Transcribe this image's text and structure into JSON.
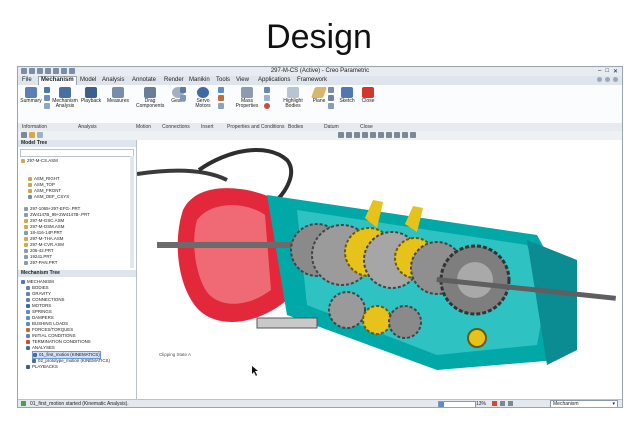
{
  "slide": {
    "title": "Design"
  },
  "window": {
    "title": "297-M-CS (Active) - Creo Parametric"
  },
  "menu": {
    "tabs": [
      "File",
      "Mechanism",
      "Model",
      "Analysis",
      "Annotate",
      "Render",
      "Manikin",
      "Tools",
      "View",
      "Applications",
      "Framework"
    ],
    "active": "Mechanism"
  },
  "ribbon": {
    "buttons": {
      "summary": "Summary",
      "mechanism_analysis": "Mechanism Analysis",
      "playback": "Playback",
      "measures": "Measures",
      "drag_components": "Drag Components",
      "gears": "Gears",
      "servo_motors": "Servo Motors",
      "mass_properties": "Mass Properties",
      "highlight_bodies": "Highlight Bodies",
      "plane": "Plane",
      "sketch": "Sketch",
      "close": "Close"
    },
    "groups": {
      "information": "Information",
      "analysis": "Analysis",
      "motion": "Motion",
      "connections": "Connections",
      "insert": "Insert",
      "properties": "Properties and Conditions",
      "bodies": "Bodies",
      "datum": "Datum",
      "close": "Close"
    }
  },
  "model_tree": {
    "header": "Model Tree",
    "items": [
      "297-M-CS.ASM",
      "ASM_RIGHT",
      "ASM_TOP",
      "ASM_FRONT",
      "ASM_DEF_CSYS",
      "297-1065+297-EFG-.PRT",
      "2W4147B_99+2W4147B-.PRT",
      "297-M-GSC.ASM",
      "297-M-DSM.ASM",
      "18-416-14P.PRT",
      "297-M-THA.ASM",
      "297-M-CVR.ASM",
      "206-42.PRT",
      "19241.PRT",
      "297-PAN.PRT"
    ]
  },
  "mechanism_tree": {
    "header": "Mechanism Tree",
    "items": [
      "MECHANISM",
      "BODIES",
      "GRAVITY",
      "CONNECTIONS",
      "MOTORS",
      "SPRINGS",
      "DAMPERS",
      "BUSHING LOADS",
      "FORCES/TORQUES",
      "INITIAL CONDITIONS",
      "TERMINATION CONDITIONS",
      "ANALYSES",
      "01_first_motion (KINEMATICS)",
      "02_prototype_motion (KINEMATICS)",
      "PLAYBACKS"
    ]
  },
  "viewport": {
    "clip_label": "Clipping State A"
  },
  "status": {
    "message": "01_first_motion started (Kinematic Analysis).",
    "progress": "13%",
    "mode": "Mechanism"
  },
  "colors": {
    "housing_red": "#e2283a",
    "housing_teal": "#00a8a8",
    "gear_yellow": "#e6c21a",
    "gear_gray": "#8a8a8a",
    "selection_blue": "#3366cc"
  }
}
